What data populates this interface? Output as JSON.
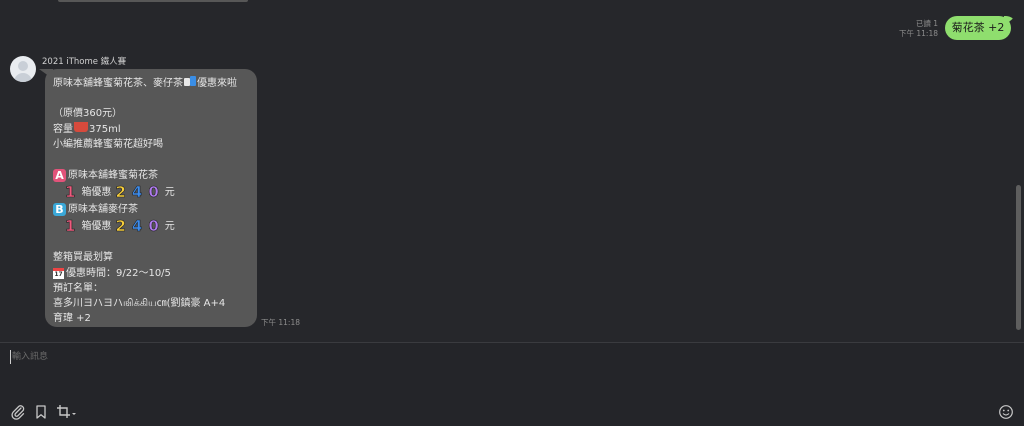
{
  "outgoing": {
    "read_status": "已讀 1",
    "time": "下午 11:18",
    "text": "菊花茶 +2"
  },
  "incoming": {
    "sender": "2021 iThome 鐵人賽",
    "time": "下午 11:18",
    "line1": "原味本舖蜂蜜菊花茶、麥仔茶",
    "line1_tail": "優惠來啦",
    "price": "（原價360元）",
    "capacity_label": "容量",
    "capacity_value": "375ml",
    "recommend": "小編推薦蜂蜜菊花超好喝",
    "item_a_letter": "A",
    "item_a_name": "原味本舖蜂蜜菊花茶",
    "item_b_letter": "B",
    "item_b_name": "原味本舖麥仔茶",
    "qty": "1",
    "qty_label": "箱優惠",
    "price_d1": "2",
    "price_d2": "4",
    "price_d3": "0",
    "currency": "元",
    "bulk": "整箱買最划算",
    "period_label": "優惠時間：9/22～10/5",
    "calendar_day": "17",
    "order_list": "預訂名單：",
    "order_names": "喜多川ヨハヨハஙிக்கிய㎝(劉鎮豪 A+4",
    "order_names2": "育瑋 +2"
  },
  "composer": {
    "placeholder": "輸入訊息"
  },
  "icons": {
    "attach": "paperclip-icon",
    "bookmark": "bookmark-icon",
    "screenshot": "crop-icon",
    "emoji": "emoji-icon"
  },
  "colors": {
    "outgoing_bubble": "#8fde6e",
    "incoming_bubble": "#575757",
    "background": "#26272b"
  }
}
